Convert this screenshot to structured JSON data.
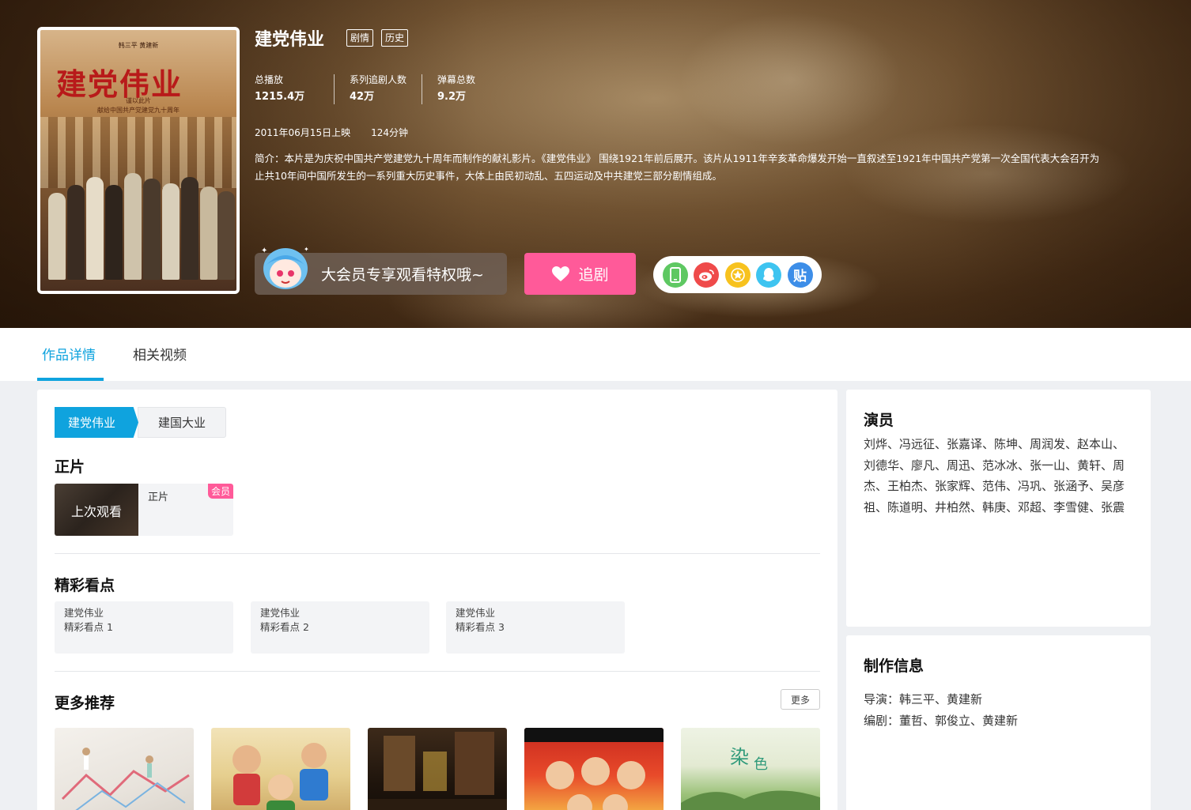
{
  "hero": {
    "poster_title": "建党伟业",
    "poster_top": "韩三平 黄建新",
    "poster_sub_1": "谨以此片",
    "poster_sub_2": "献给中国共产党建党九十周年",
    "title": "建党伟业",
    "tags": [
      "剧情",
      "历史"
    ],
    "stats": [
      {
        "label": "总播放",
        "value": "1215.4万"
      },
      {
        "label": "系列追剧人数",
        "value": "42万"
      },
      {
        "label": "弹幕总数",
        "value": "9.2万"
      }
    ],
    "release_date": "2011年06月15日上映",
    "duration": "124分钟",
    "synopsis": "简介：本片是为庆祝中国共产党建党九十周年而制作的献礼影片。《建党伟业》 围绕1921年前后展开。该片从1911年辛亥革命爆发开始一直叙述至1921年中国共产党第一次全国代表大会召开为止共10年间中国所发生的一系列重大历史事件，大体上由民初动乱、五四运动及中共建党三部分剧情组成。",
    "vip_text": "大会员专享观看特权哦~",
    "follow_label": "追剧",
    "share_icons": [
      "phone-icon",
      "weibo-icon",
      "qzone-icon",
      "qq-icon",
      "tieba-icon"
    ],
    "share_tieba_glyph": "贴"
  },
  "tabs": [
    {
      "label": "作品详情",
      "active": true
    },
    {
      "label": "相关视频",
      "active": false
    }
  ],
  "main": {
    "series": [
      "建党伟业",
      "建国大业"
    ],
    "feature_title": "正片",
    "episode": {
      "thumb_label": "上次观看",
      "name": "正片",
      "badge": "会员"
    },
    "highlights_title": "精彩看点",
    "highlights": [
      {
        "title": "建党伟业",
        "sub": "精彩看点 1"
      },
      {
        "title": "建党伟业",
        "sub": "精彩看点 2"
      },
      {
        "title": "建党伟业",
        "sub": "精彩看点 3"
      }
    ],
    "more_title": "更多推荐",
    "more_button": "更多"
  },
  "cast": {
    "title": "演员",
    "names": "刘烨、冯远征、张嘉译、陈坤、周润发、赵本山、刘德华、廖凡、周迅、范冰冰、张一山、黄轩、周杰、王柏杰、张家辉、范伟、冯巩、张涵予、吴彦祖、陈道明、井柏然、韩庚、邓超、李雪健、张震"
  },
  "production": {
    "title": "制作信息",
    "director": "导演：韩三平、黄建新",
    "writer": "编剧：董哲、郭俊立、黄建新"
  },
  "colors": {
    "accent": "#0fa3de",
    "pink": "#ff5a99"
  }
}
